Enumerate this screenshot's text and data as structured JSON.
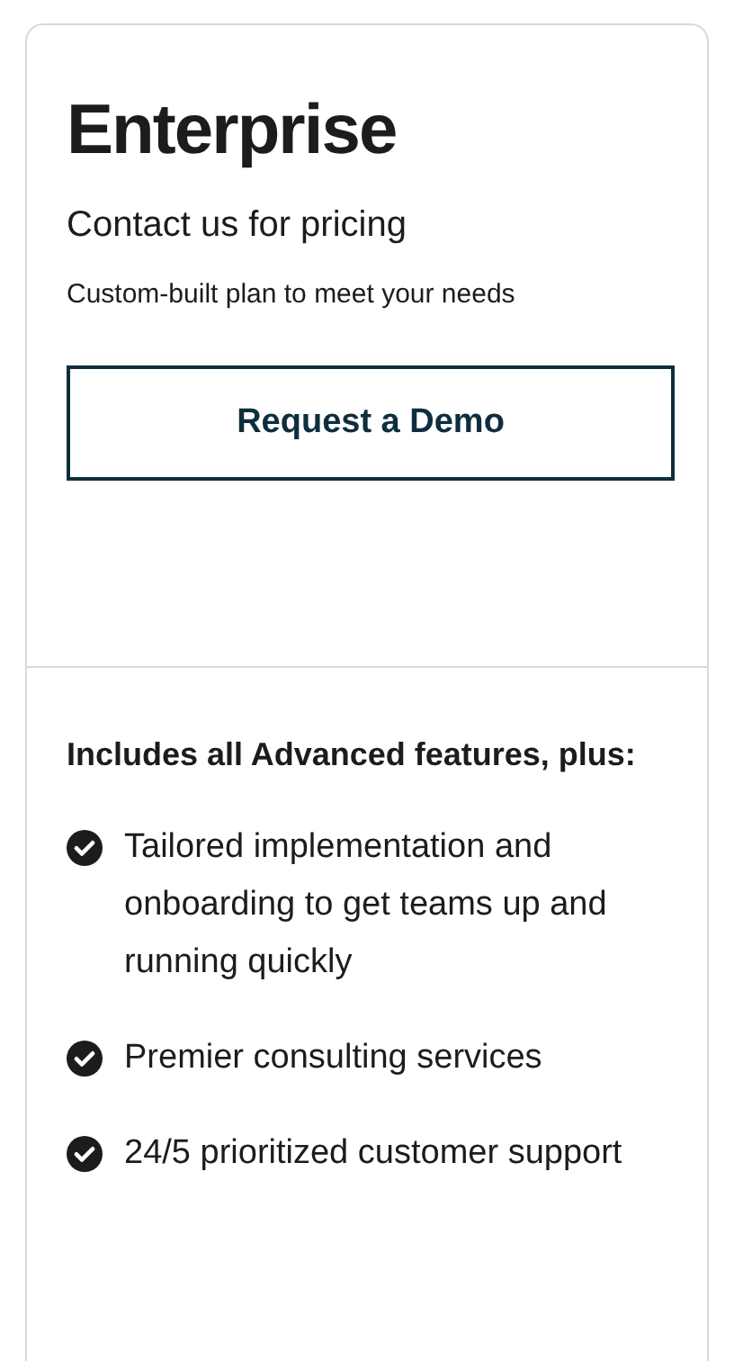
{
  "plan": {
    "name": "Enterprise",
    "price": "Contact us for pricing",
    "description": "Custom-built plan to meet your needs",
    "button": "Request a Demo"
  },
  "features": {
    "heading": "Includes all Advanced features, plus:",
    "items": [
      {
        "text": "Tailored implementation and onboarding to get teams up and running quickly",
        "checked": true
      },
      {
        "text": "Premier consulting services",
        "checked": true
      },
      {
        "text": "24/5 prioritized customer support",
        "checked": true
      }
    ]
  }
}
